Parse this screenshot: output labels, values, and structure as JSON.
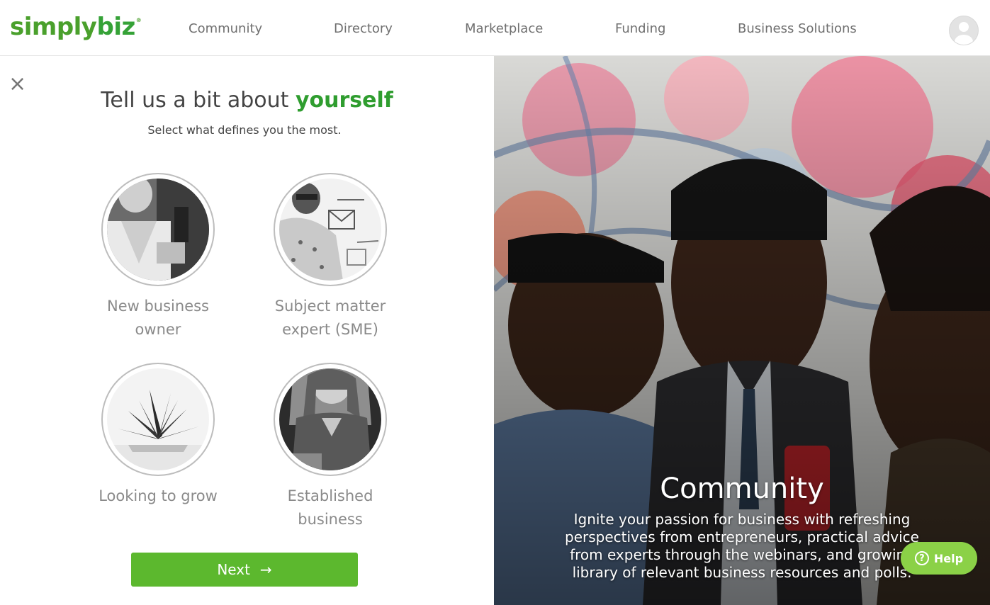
{
  "brand": {
    "logo_part1": "simply",
    "logo_part2": "biz",
    "logo_mark": "®"
  },
  "nav": {
    "items": [
      "Community",
      "Directory",
      "Marketplace",
      "Funding",
      "Business Solutions"
    ]
  },
  "close_icon": "×",
  "form": {
    "heading_prefix": "Tell us a bit about ",
    "heading_accent": "yourself",
    "subheading": "Select what defines you the most.",
    "options": [
      {
        "line1": "New business",
        "line2": "owner",
        "icon": "person-photo"
      },
      {
        "line1": "Subject matter",
        "line2": "expert (SME)",
        "icon": "whiteboard-photo"
      },
      {
        "line1": "Looking to grow",
        "line2": "",
        "icon": "plant-photo"
      },
      {
        "line1": "Established",
        "line2": "business",
        "icon": "woman-photo"
      }
    ],
    "next_label": "Next",
    "next_arrow": "→"
  },
  "hero": {
    "title": "Community",
    "text": "Ignite your passion for business with refreshing perspectives from entrepreneurs, practical advice from experts through the webinars, and growing library of relevant business resources and polls."
  },
  "help": {
    "label": "Help",
    "icon_glyph": "?"
  },
  "colors": {
    "brand_green": "#4aa02c",
    "button_green": "#5cb82e",
    "help_green": "#8bd147"
  }
}
